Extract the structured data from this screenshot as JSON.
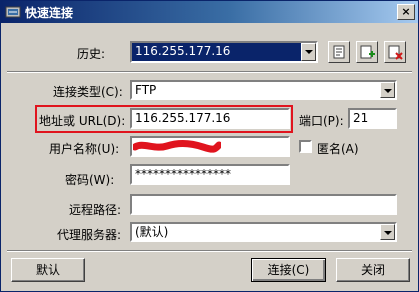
{
  "window": {
    "title": "快速连接",
    "close_label": "×"
  },
  "history": {
    "label": "历史:",
    "value": "116.255.177.16"
  },
  "connection_type": {
    "label": "连接类型(C):",
    "value": "FTP"
  },
  "address": {
    "label": "地址或 URL(D):",
    "value": "116.255.177.16"
  },
  "port": {
    "label": "端口(P):",
    "value": "21"
  },
  "username": {
    "label": "用户名称(U):",
    "value": ""
  },
  "anonymous": {
    "label": "匿名(A)",
    "checked": false
  },
  "password": {
    "label": "密码(W):",
    "value": "****************"
  },
  "remote_path": {
    "label": "远程路径:",
    "value": ""
  },
  "proxy": {
    "label": "代理服务器:",
    "value": "(默认)"
  },
  "buttons": {
    "default": "默认",
    "connect": "连接(C)",
    "close": "关闭"
  },
  "colors": {
    "title_bar": "#0a246a",
    "highlight": "#e0141e",
    "redaction": "#e0141e"
  },
  "icons": [
    "connection-app-icon",
    "dropdown-arrow-icon",
    "properties-icon",
    "add-icon",
    "delete-icon"
  ]
}
